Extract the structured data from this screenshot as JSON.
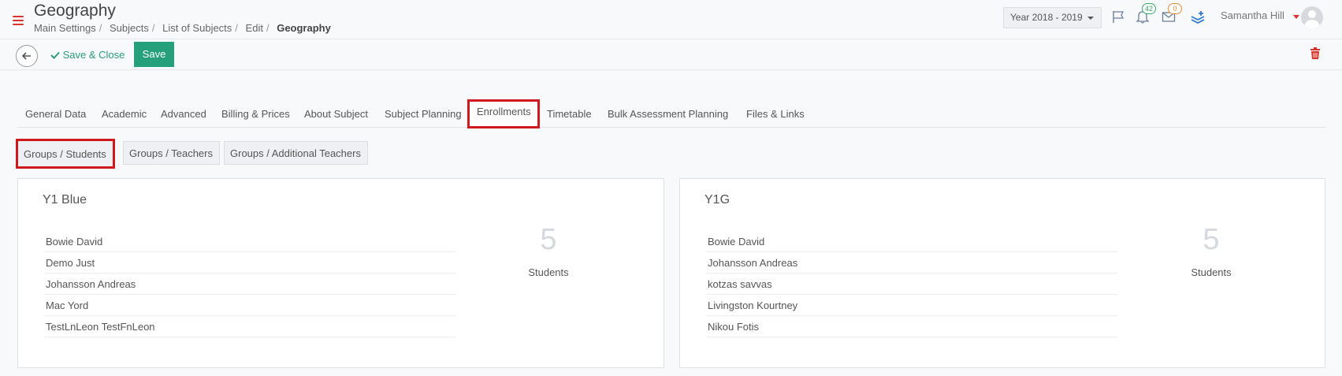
{
  "header": {
    "title": "Geography",
    "breadcrumb": [
      {
        "label": "Main Settings"
      },
      {
        "label": "Subjects"
      },
      {
        "label": "List of Subjects"
      },
      {
        "label": "Edit"
      }
    ],
    "breadcrumb_current": "Geography",
    "breadcrumb_separator": "/",
    "year_select": "Year 2018 - 2019",
    "notifications_count": "42",
    "messages_count": "0",
    "user_name": "Samantha Hill"
  },
  "toolbar": {
    "save_close_label": "Save & Close",
    "save_label": "Save"
  },
  "tabs": [
    {
      "label": "General Data"
    },
    {
      "label": "Academic"
    },
    {
      "label": "Advanced"
    },
    {
      "label": "Billing & Prices"
    },
    {
      "label": "About Subject"
    },
    {
      "label": "Subject Planning"
    },
    {
      "label": "Enrollments",
      "active": true
    },
    {
      "label": "Timetable"
    },
    {
      "label": "Bulk Assessment Planning"
    },
    {
      "label": "Files & Links"
    }
  ],
  "subtabs": [
    {
      "label": "Groups / Students",
      "active": true
    },
    {
      "label": "Groups / Teachers"
    },
    {
      "label": "Groups / Additional Teachers"
    }
  ],
  "groups": [
    {
      "name": "Y1 Blue",
      "students": [
        "Bowie David",
        "Demo Just",
        "Johansson Andreas",
        "Mac Yord",
        "TestLnLeon TestFnLeon"
      ],
      "count": "5",
      "count_label": "Students"
    },
    {
      "name": "Y1G",
      "students": [
        "Bowie David",
        "Johansson Andreas",
        "kotzas savvas",
        "Livingston Kourtney",
        "Nikou Fotis"
      ],
      "count": "5",
      "count_label": "Students"
    }
  ],
  "colors": {
    "accent_red": "#d9342b",
    "save_green": "#25a07b",
    "highlight_border": "#d0191e"
  }
}
